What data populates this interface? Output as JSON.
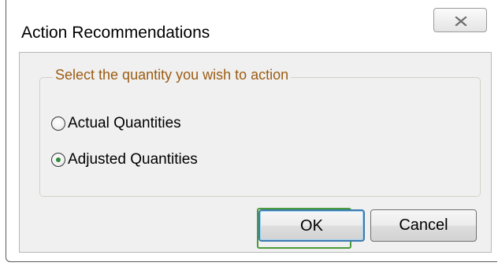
{
  "dialog": {
    "title": "Action Recommendations",
    "close_icon": "close-x-icon"
  },
  "group": {
    "legend": "Select the quantity you wish to action",
    "options": [
      {
        "label": "Actual Quantities",
        "selected": false
      },
      {
        "label": "Adjusted Quantities",
        "selected": true
      }
    ]
  },
  "buttons": {
    "ok_label": "OK",
    "cancel_label": "Cancel"
  },
  "colors": {
    "legend_text": "#9b5c13",
    "radio_selected": "#2f8a3b",
    "ok_border": "#3d7bad"
  }
}
